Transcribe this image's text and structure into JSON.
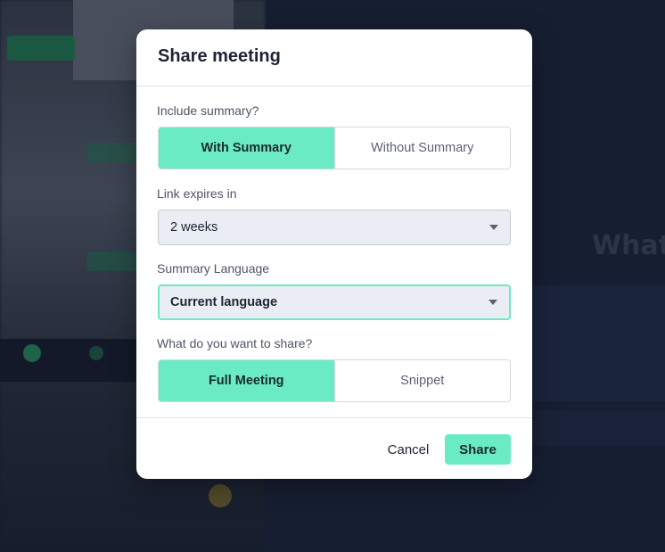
{
  "modal": {
    "title": "Share meeting",
    "summary": {
      "label": "Include summary?",
      "options": [
        "With Summary",
        "Without Summary"
      ],
      "selected": "With Summary"
    },
    "expiry": {
      "label": "Link expires in",
      "value": "2 weeks"
    },
    "language": {
      "label": "Summary Language",
      "value": "Current language"
    },
    "share_scope": {
      "label": "What do you want to share?",
      "options": [
        "Full Meeting",
        "Snippet"
      ],
      "selected": "Full Meeting"
    },
    "footer": {
      "cancel_label": "Cancel",
      "share_label": "Share"
    }
  },
  "background": {
    "title_fragment": "What"
  },
  "colors": {
    "accent": "#6aebc4",
    "backdrop": "#1d2538"
  }
}
